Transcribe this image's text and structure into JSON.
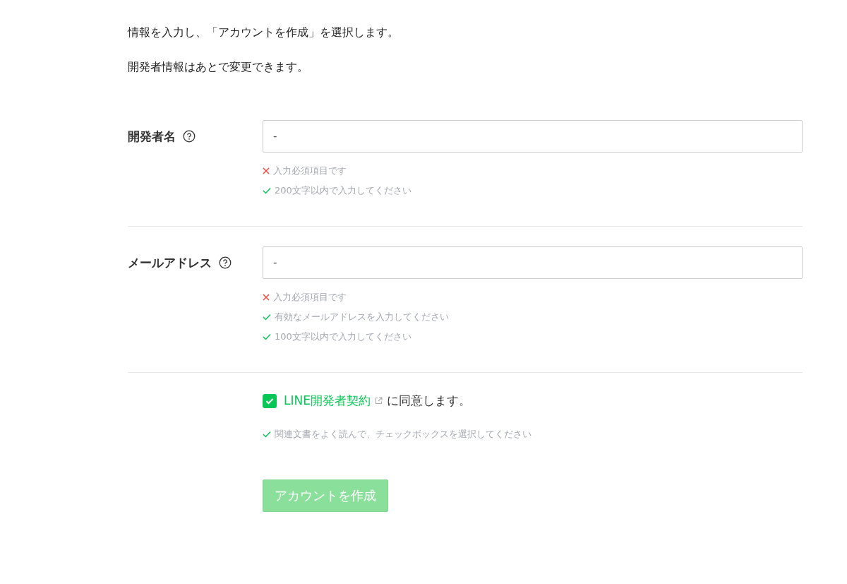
{
  "intro": [
    "情報を入力し、「アカウントを作成」を選択します。",
    "開発者情報はあとで変更できます。"
  ],
  "fields": [
    {
      "label": "開発者名",
      "value": "-",
      "rules": [
        {
          "text": "入力必須項目です",
          "passed": false
        },
        {
          "text": "200文字以内で入力してください",
          "passed": true
        }
      ]
    },
    {
      "label": "メールアドレス",
      "value": "-",
      "rules": [
        {
          "text": "入力必須項目です",
          "passed": false
        },
        {
          "text": "有効なメールアドレスを入力してください",
          "passed": true
        },
        {
          "text": "100文字以内で入力してください",
          "passed": true
        }
      ]
    }
  ],
  "agreement": {
    "checked": true,
    "link": "LINE開発者契約",
    "text": "に同意します。",
    "rules": [
      {
        "text": "関連文書をよく読んで、チェックボックスを選択してください",
        "passed": true
      }
    ]
  },
  "submit": {
    "label": "アカウントを作成",
    "disabled": true
  }
}
